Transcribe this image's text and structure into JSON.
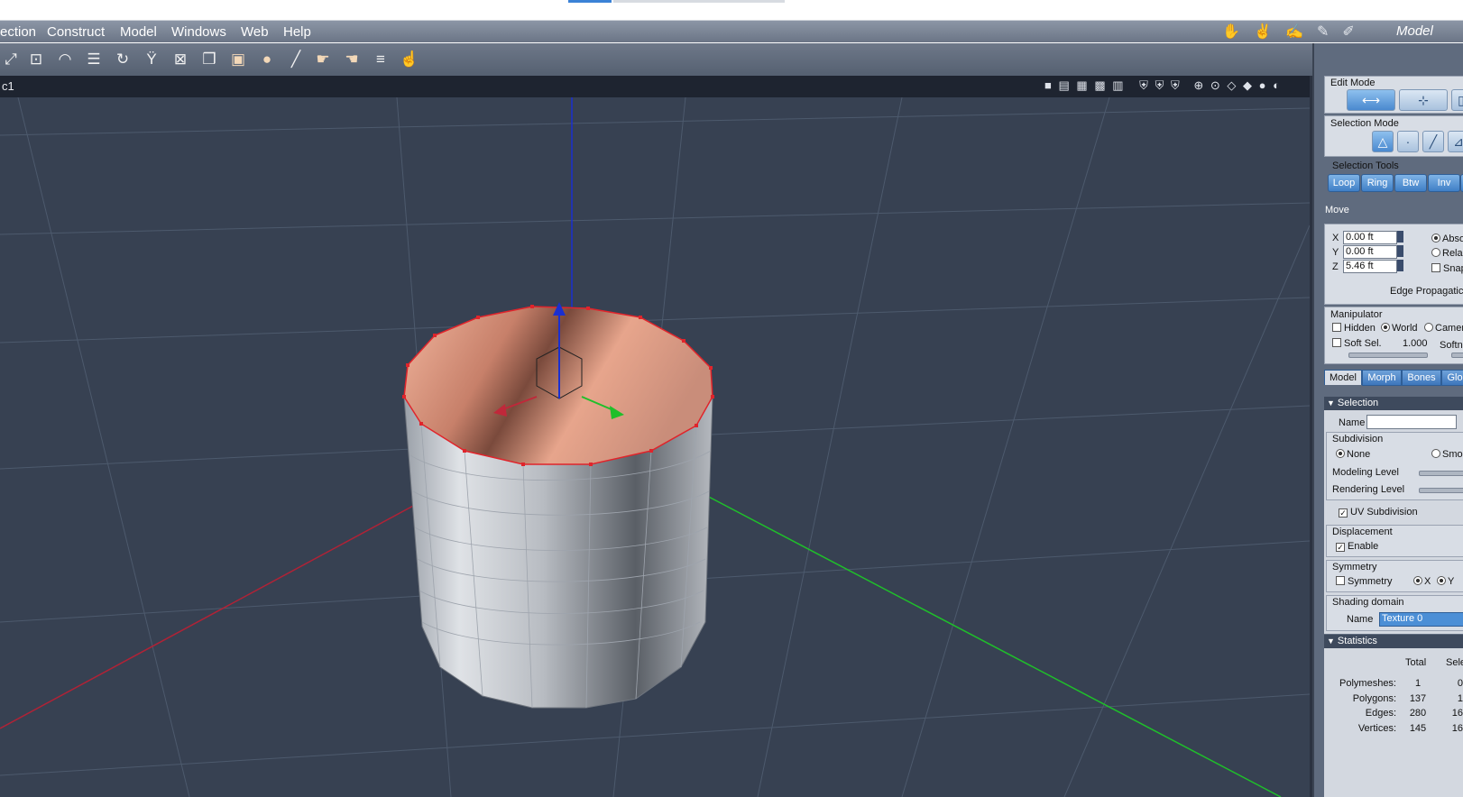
{
  "menubar": {
    "items": [
      "ection",
      "Construct",
      "Model",
      "Windows",
      "Web",
      "Help"
    ],
    "mode_label": "Model"
  },
  "viewport": {
    "name": "c1"
  },
  "edit_mode": {
    "title": "Edit Mode",
    "selection_mode_title": "Selection Mode",
    "selection_tools_title": "Selection Tools",
    "tools": [
      "Loop",
      "Ring",
      "Btw",
      "Inv"
    ],
    "move_label": "Move"
  },
  "move": {
    "x_label": "X",
    "x_value": "0.00 ft",
    "y_label": "Y",
    "y_value": "0.00 ft",
    "z_label": "Z",
    "z_value": "5.46 ft",
    "absolute": "Abso",
    "relative": "Rela",
    "snap": "Snap",
    "edge_propagation": "Edge Propagatic"
  },
  "manipulator": {
    "title": "Manipulator",
    "hidden": "Hidden",
    "world": "World",
    "camera": "Camer",
    "soft_sel": "Soft Sel.",
    "soft_sel_value": "1.000",
    "soft_label": "Softn"
  },
  "tabs": [
    "Model",
    "Morph",
    "Bones",
    "Glo"
  ],
  "selection": {
    "header": "Selection",
    "name_label": "Name",
    "name_value": ""
  },
  "subdivision": {
    "title": "Subdivision",
    "none": "None",
    "smooth": "Smo",
    "modeling_level": "Modeling Level",
    "rendering_level": "Rendering Level",
    "uv_subdivision": "UV Subdivision"
  },
  "displacement": {
    "title": "Displacement",
    "enable": "Enable"
  },
  "symmetry": {
    "title": "Symmetry",
    "label": "Symmetry",
    "x": "X",
    "y": "Y"
  },
  "shading": {
    "title": "Shading domain",
    "name_label": "Name",
    "value": "Texture 0"
  },
  "statistics": {
    "header": "Statistics",
    "col_total": "Total",
    "col_sel": "Sele",
    "rows": [
      {
        "label": "Polymeshes:",
        "total": "1",
        "sel": "0"
      },
      {
        "label": "Polygons:",
        "total": "137",
        "sel": "1"
      },
      {
        "label": "Edges:",
        "total": "280",
        "sel": "16"
      },
      {
        "label": "Vertices:",
        "total": "145",
        "sel": "16"
      }
    ]
  },
  "colors": {
    "viewport_bg": "#374152",
    "top_face": "#e9a58e",
    "accent_blue": "#3f7fc6",
    "axis_x": "#c0283a",
    "axis_y": "#1fbf2a",
    "axis_z": "#1a2fd0"
  }
}
